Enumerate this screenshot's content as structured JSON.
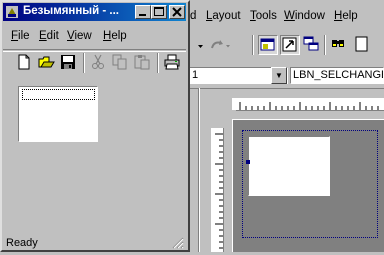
{
  "child_window": {
    "title": "Безымянный - ...",
    "caption_buttons": [
      "minimize",
      "maximize",
      "close"
    ],
    "menu": [
      {
        "label": "File",
        "mnemonic_index": 0
      },
      {
        "label": "Edit",
        "mnemonic_index": 0
      },
      {
        "label": "View",
        "mnemonic_index": 0
      },
      {
        "label": "Help",
        "mnemonic_index": 0
      }
    ],
    "toolbar": [
      "new-icon",
      "open-icon",
      "save-icon",
      "cut-icon",
      "copy-icon",
      "paste-icon",
      "print-icon"
    ],
    "status": "Ready"
  },
  "background_app": {
    "menu": [
      {
        "label": "d"
      },
      {
        "label": "Layout",
        "mnemonic_index": 0
      },
      {
        "label": "Tools",
        "mnemonic_index": 0
      },
      {
        "label": "Window",
        "mnemonic_index": 0
      },
      {
        "label": "Help",
        "mnemonic_index": 0
      }
    ],
    "combo_left_value": "1",
    "combo_right_value": "LBN_SELCHANGE"
  },
  "colors": {
    "face": "#c0c0c0",
    "title_active": "#000080",
    "title_gradient_end": "#1084d0"
  }
}
